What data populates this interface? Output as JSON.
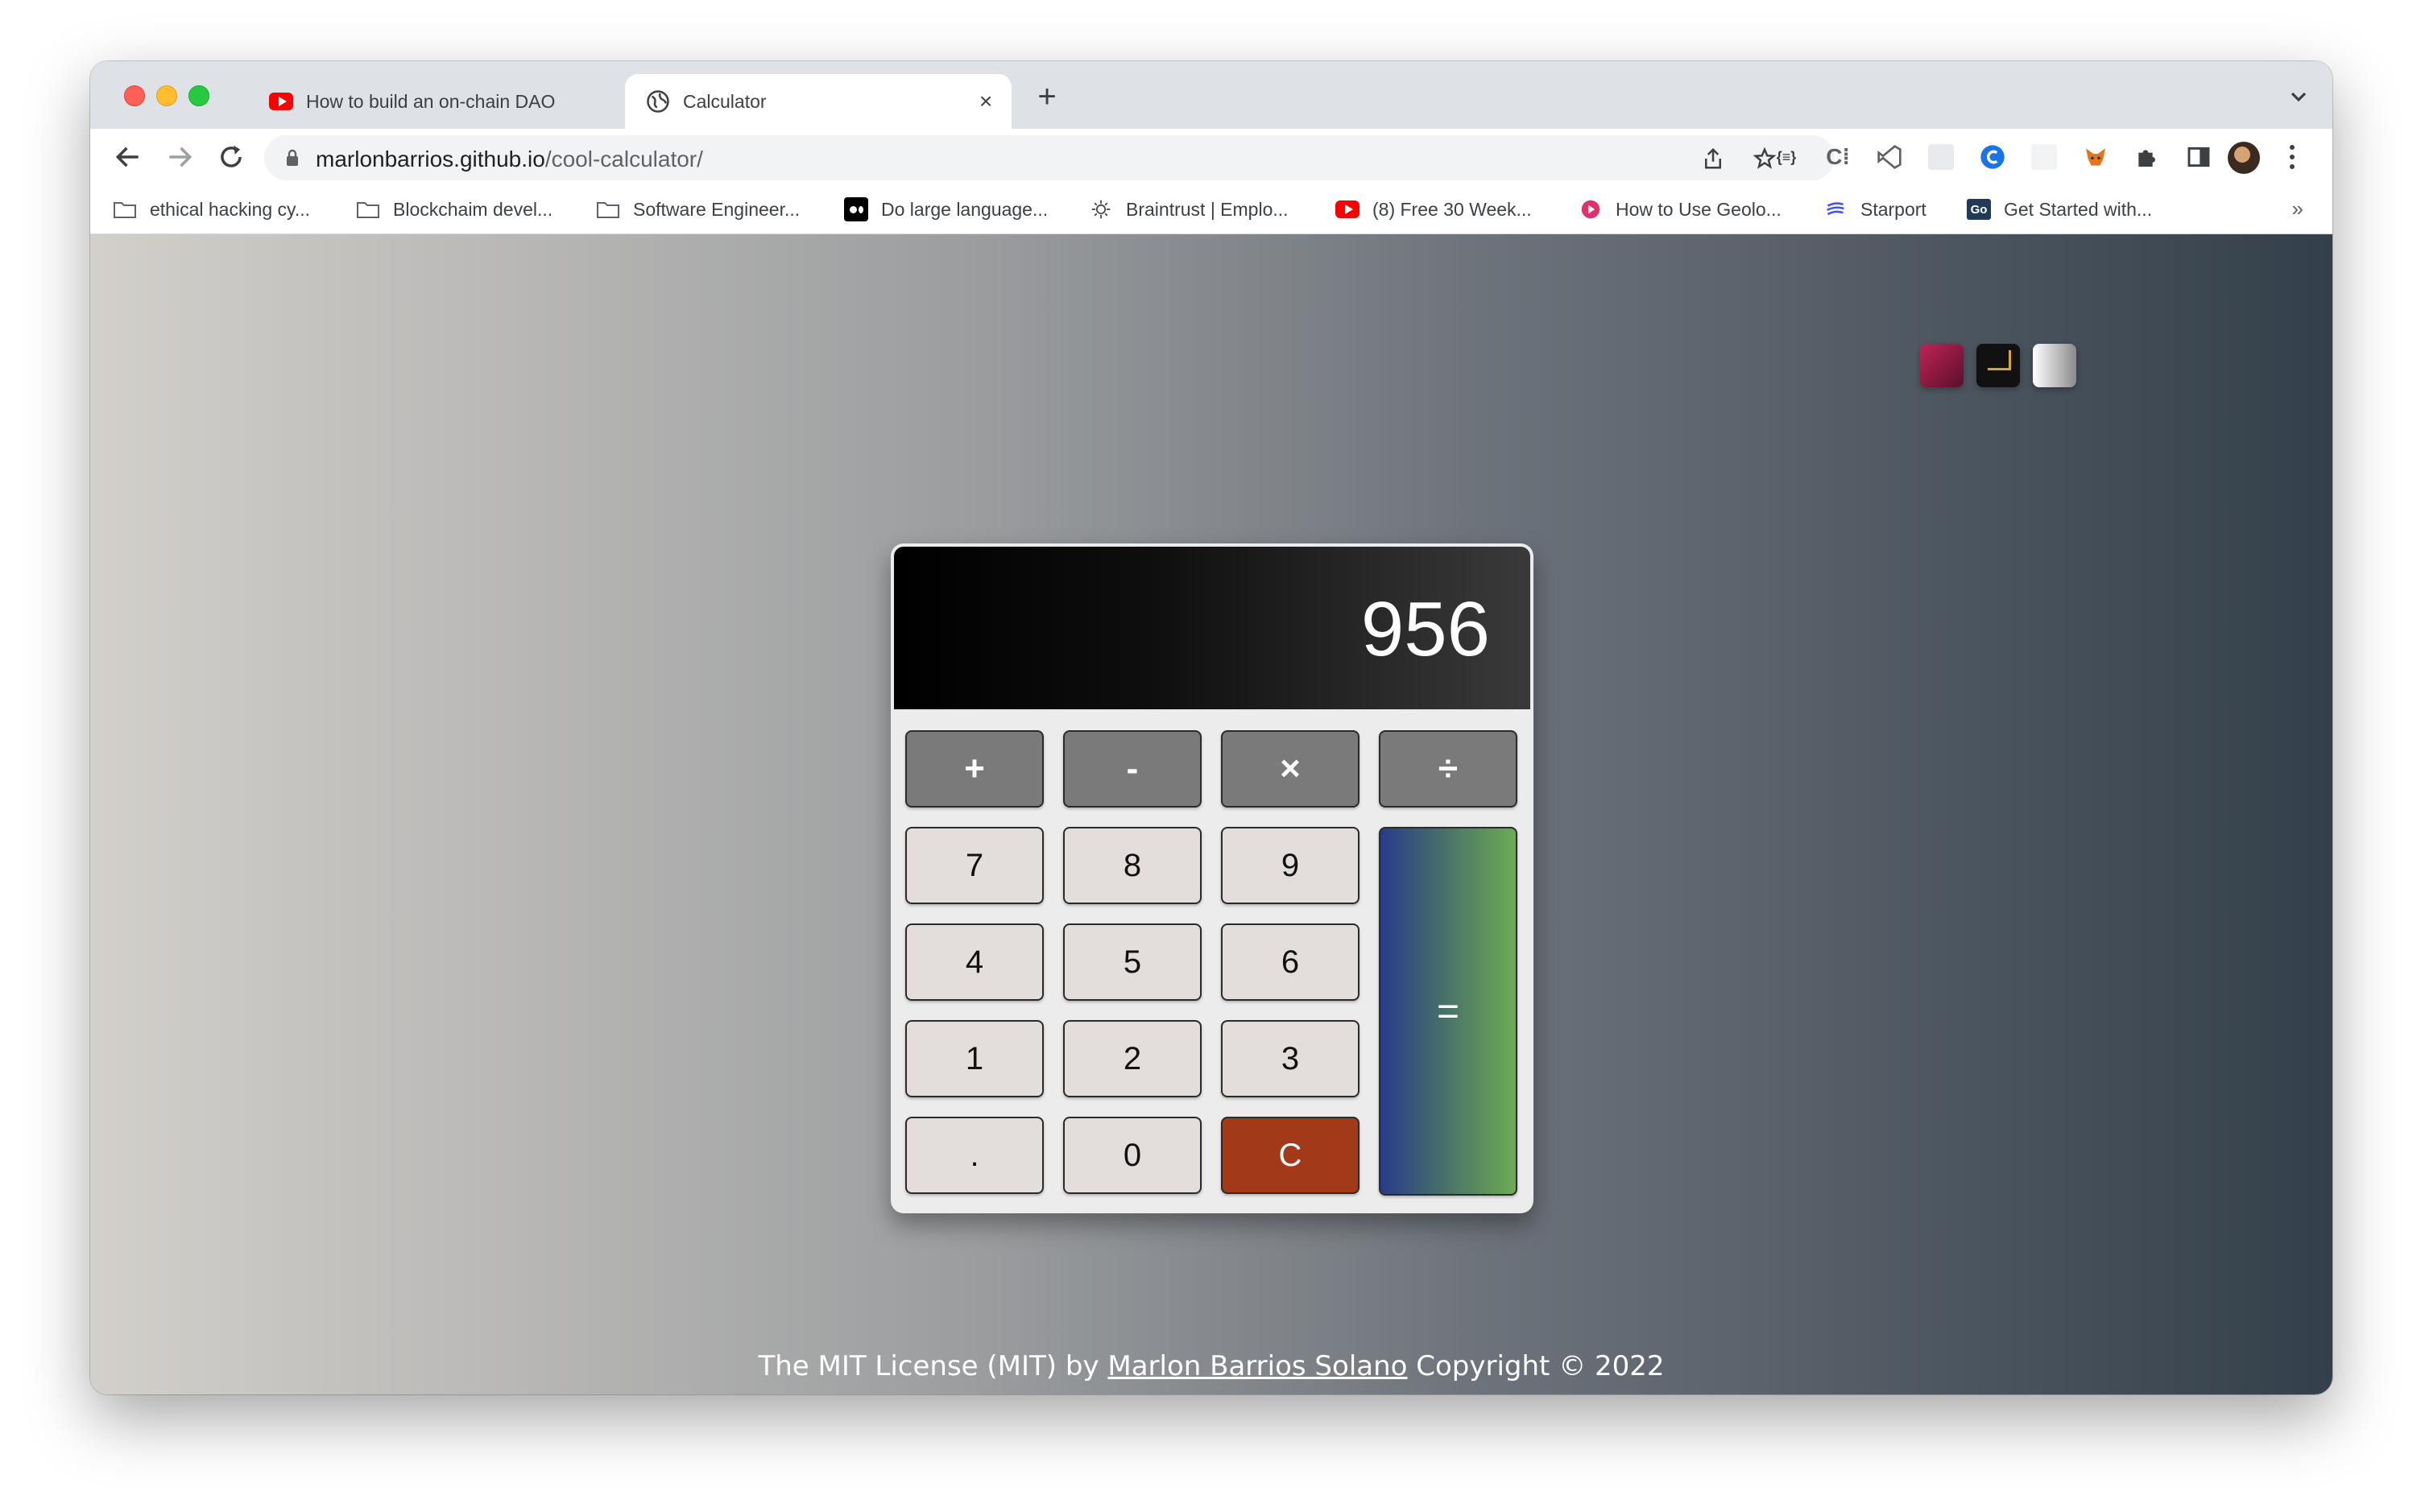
{
  "browser": {
    "tabs": [
      {
        "title": "How to build an on-chain DAO",
        "icon": "youtube-icon",
        "active": false
      },
      {
        "title": "Calculator",
        "icon": "globe-icon",
        "active": true
      }
    ],
    "new_tab_label": "+",
    "address": {
      "host": "marlonbarrios.github.io",
      "path": "/cool-calculator/"
    },
    "bookmarks": [
      {
        "label": "ethical hacking cy...",
        "icon": "folder-icon"
      },
      {
        "label": "Blockchaim devel...",
        "icon": "folder-icon"
      },
      {
        "label": "Software Engineer...",
        "icon": "folder-icon"
      },
      {
        "label": "Do large language...",
        "icon": "medium-icon"
      },
      {
        "label": "Braintrust | Emplo...",
        "icon": "sun-icon"
      },
      {
        "label": "(8) Free 30 Week...",
        "icon": "youtube-icon"
      },
      {
        "label": "How to Use Geolo...",
        "icon": "pink-play-icon"
      },
      {
        "label": "Starport",
        "icon": "starport-icon"
      },
      {
        "label": "Get Started with...",
        "icon": "go-icon"
      }
    ],
    "bookmarks_overflow": "»"
  },
  "calculator": {
    "display": "956",
    "operators": [
      "+",
      "-",
      "×",
      "÷"
    ],
    "digits_rows": [
      [
        "7",
        "8",
        "9"
      ],
      [
        "4",
        "5",
        "6"
      ],
      [
        "1",
        "2",
        "3"
      ]
    ],
    "bottom_row": [
      ".",
      "0",
      "C"
    ],
    "equals": "="
  },
  "theme_switcher": [
    "red-theme",
    "dark-theme",
    "light-theme"
  ],
  "footer": {
    "prefix": "The MIT License (MIT) by ",
    "author": "Marlon Barrios Solano",
    "suffix": " Copyright © 2022"
  },
  "colors": {
    "clear_key": "#a23a19",
    "operator_key": "#7a7a7a",
    "equals_gradient_start": "#283c88",
    "equals_gradient_end": "#6cab54"
  }
}
